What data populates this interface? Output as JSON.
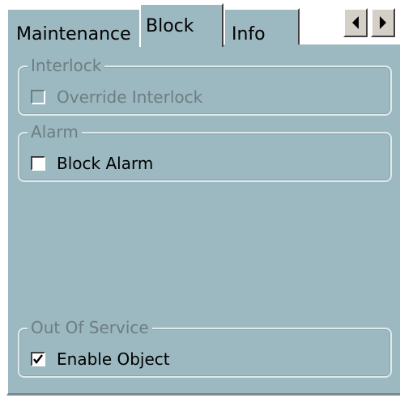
{
  "tabs": [
    {
      "label": "Maintenance",
      "active": false
    },
    {
      "label": "Block",
      "active": true
    },
    {
      "label": "Info",
      "active": false
    }
  ],
  "scroll": {
    "left_icon": "arrow-left-icon",
    "right_icon": "arrow-right-icon"
  },
  "groups": {
    "interlock": {
      "title": "Interlock",
      "checkbox_label": "Override Interlock",
      "checked": false,
      "enabled": false
    },
    "alarm": {
      "title": "Alarm",
      "checkbox_label": "Block Alarm",
      "checked": false,
      "enabled": true
    },
    "out_of_service": {
      "title": "Out Of Service",
      "checkbox_label": "Enable Object",
      "checked": true,
      "enabled": true
    }
  },
  "colors": {
    "panel": "#9cb8c0",
    "group_title": "#6d7e82",
    "disabled_text": "#6d7e82"
  }
}
